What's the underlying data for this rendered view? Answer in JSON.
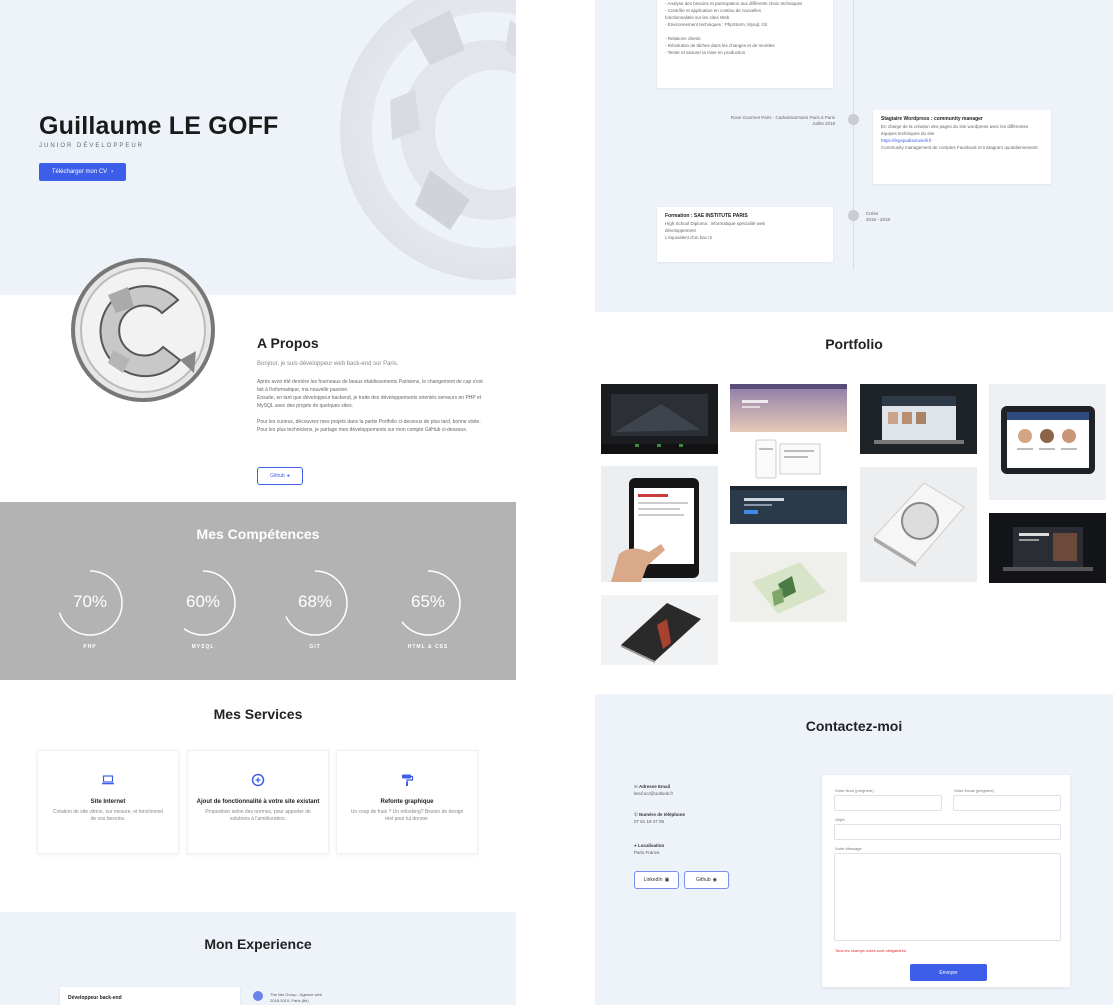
{
  "hero": {
    "name": "Guillaume LE GOFF",
    "subtitle": "JUNIOR DÉVELOPPEUR",
    "cv_button": "Télécharger mon CV"
  },
  "about": {
    "title": "A Propos",
    "lead": "Bonjour, je suis développeur web back-end sur Paris.",
    "paragraph1": "Après avoir été derrière les fourneaux de beaux établissements Parisiens, le changement de cap s'est fait à l'informatique, ma nouvelle passion.",
    "paragraph2": "Ensuite, en tant que développeur backend, je traite des développements orientés serveurs en PHP et MySQL avec des projets de quelques sites.",
    "paragraph3": "Pour les curieux, découvrez mes projets dans la partie Portfolio ci-dessous de plus tard, bonne visite.",
    "paragraph4": "Pour les plus techniciens, je partage mes développements sur mon compte GitHub ci-dessous.",
    "github_button": "Github"
  },
  "skills": {
    "title": "Mes Compétences",
    "items": [
      {
        "value": "70%",
        "percent": 70,
        "label": "PHP"
      },
      {
        "value": "60%",
        "percent": 60,
        "label": "MYSQL"
      },
      {
        "value": "68%",
        "percent": 68,
        "label": "GIT"
      },
      {
        "value": "65%",
        "percent": 65,
        "label": "HTML & CSS"
      }
    ]
  },
  "services": {
    "title": "Mes Services",
    "items": [
      {
        "icon": "laptop-icon",
        "name": "Site Internet",
        "desc": "Création de site vitrine, sur mesure, et fonctionnel de vos besoins."
      },
      {
        "icon": "plus-circle-icon",
        "name": "Ajout de fonctionnalité à votre site existant",
        "desc": "Proposition selon des normes, pour apporter de solutions à l'amélioration."
      },
      {
        "icon": "paint-roller-icon",
        "name": "Refonte graphique",
        "desc": "Un coup de frais ? Un relooking? Besoin de design réel pour lui donner."
      }
    ]
  },
  "experience": {
    "title": "Mon Experience",
    "card_title": "Développeur back-end",
    "meta_line1": "The Net Group - Agence web",
    "meta_line2": "2018-2019, Paris (8e)"
  },
  "timeline": {
    "top_card_lines": [
      "- Analyse des besoins et participation aux différents choix techniques",
      "- Contrôle et application en continu de nouvelles",
      "fonctionnalités sur les sites Web",
      "- Environnement techniques : PhpStorm, Mysql, Git",
      "",
      "- Relations clients",
      "- Résolution de tâches dans les changes et de recettes",
      "- Tester et assurer la mise en production"
    ],
    "entry2_meta_line1": "Rose Gourmet Paris - Cadvalmarmaris Paris à Paris",
    "entry2_meta_line2": "Juillet 2018",
    "entry2_title": "Stagiaire Wordpress : community manager",
    "entry2_lines": [
      "En charge de la création des pages du site wordpress avec les différentes équipes techniques du site",
      "https://legspadiseruselli.fr",
      "Community management de comptes Facebook et Instagram quotidiennement"
    ],
    "entry3_title": "Formation : SAE INSTITUTE PARIS",
    "entry3_lines": [
      "High School Diploma : informatique spécialité web",
      "développement",
      "L'équivalent d'un bac+2"
    ],
    "entry3_meta_line1": "Créée",
    "entry3_meta_line2": "2016 - 2018"
  },
  "portfolio": {
    "title": "Portfolio"
  },
  "contact": {
    "title": "Contactez-moi",
    "email_label": "Adresse Email",
    "email_value": "leruf.scr@outlook.fr",
    "phone_label": "Numéro de téléphone",
    "phone_value": "07 61 19 47 06",
    "location_label": "Localisation",
    "location_value": "Paris France",
    "linkedin_button": "LinkedIn",
    "github_button": "Github",
    "form": {
      "firstname_label": "Votre Nom (prégnère)",
      "lastname_label": "Votre Email (prégnère)",
      "subject_label": "Objet",
      "message_label": "Votre Message",
      "required_note": "Tous les champs notés sont obligatoires",
      "submit": "Envoyer"
    }
  },
  "colors": {
    "accent": "#3d5ee8",
    "light_bg": "#eef3fa",
    "skills_bg": "#b3b3b3",
    "error": "#e0282a"
  }
}
